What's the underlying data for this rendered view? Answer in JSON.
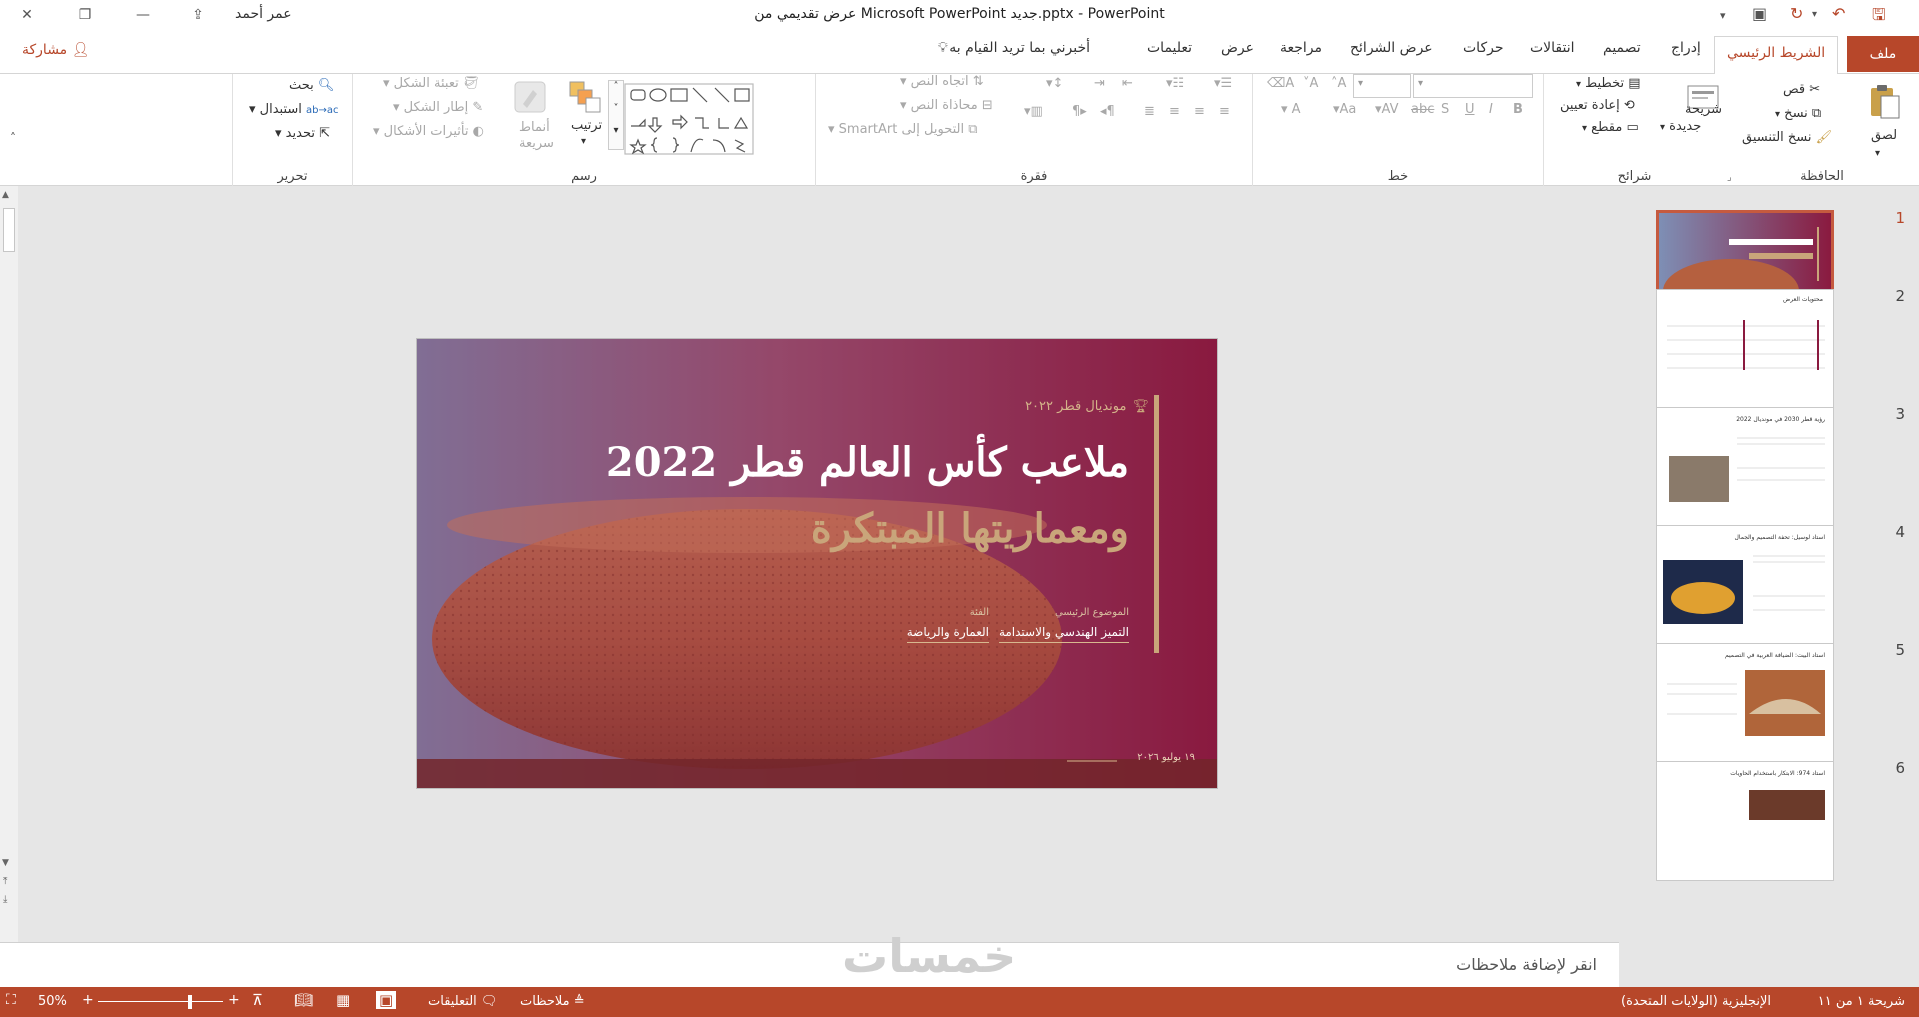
{
  "titlebar": {
    "title": "عرض تقديمي من Microsoft PowerPoint جديد.pptx  -  PowerPoint",
    "user": "عمر أحمد"
  },
  "tabs": {
    "file": "ملف",
    "home": "الشريط الرئيسي",
    "insert": "إدراج",
    "design": "تصميم",
    "transitions": "انتقالات",
    "animations": "حركات",
    "slideshow": "عرض الشرائح",
    "review": "مراجعة",
    "view": "عرض",
    "help": "تعليمات",
    "tellme": "أخبرني بما تريد القيام به",
    "share": "مشاركة"
  },
  "ribbon": {
    "clipboard": {
      "label": "الحافظة",
      "paste": "لصق",
      "cut": "قص",
      "copy": "نسخ",
      "format_painter": "نسخ التنسيق"
    },
    "slides": {
      "label": "شرائح",
      "new_slide_1": "شريحة",
      "new_slide_2": "جديدة",
      "layout": "تخطيط",
      "reset": "إعادة تعيين",
      "section": "مقطع"
    },
    "font": {
      "label": "خط"
    },
    "paragraph": {
      "label": "فقرة",
      "text_direction": "اتجاه النص",
      "align_text": "محاذاة النص",
      "smartart": "التحويل إلى SmartArt"
    },
    "drawing": {
      "label": "رسم",
      "arrange": "ترتيب",
      "quick_styles_1": "أنماط",
      "quick_styles_2": "سريعة",
      "shape_fill": "تعبئة الشكل",
      "shape_outline": "إطار الشكل",
      "shape_effects": "تأثيرات الأشكال"
    },
    "editing": {
      "label": "تحرير",
      "find": "بحث",
      "replace": "استبدال",
      "select": "تحديد"
    }
  },
  "thumbnails": {
    "numbers": [
      "1",
      "2",
      "3",
      "4",
      "5",
      "6"
    ],
    "t2_title": "محتويات العرض",
    "t3_title": "رؤية قطر 2030 في مونديال 2022",
    "t4_title": "استاد لوسيل: تحفة التصميم والجمال",
    "t5_title": "استاد البيت: الضيافة العربية في التصميم",
    "t6_title": "استاد 974: الابتكار باستخدام الحاويات"
  },
  "slide": {
    "overline": "مونديال قطر ٢٠٢٢",
    "title_line1": "ملاعب كأس العالم قطر 2022",
    "title_line2": "ومعماريتها المبتكرة",
    "meta1_label": "الموضوع الرئيسي",
    "meta1_value": "التميز الهندسي والاستدامة",
    "meta2_label": "الفئة",
    "meta2_value": "العمارة والرياضة",
    "date": "١٩ يوليو ٢٠٢٦"
  },
  "notes": {
    "placeholder": "انقر لإضافة ملاحظات"
  },
  "watermark": "خمسات",
  "status": {
    "slide_of": "شريحة ١ من ١١",
    "language": "الإنجليزية (الولايات المتحدة)",
    "notes": "ملاحظات",
    "comments": "التعليقات",
    "zoom": "50%"
  },
  "colors": {
    "accent": "#b7472a",
    "slide_maroon": "#8a1a3f",
    "slide_gold": "#c9a57a"
  }
}
